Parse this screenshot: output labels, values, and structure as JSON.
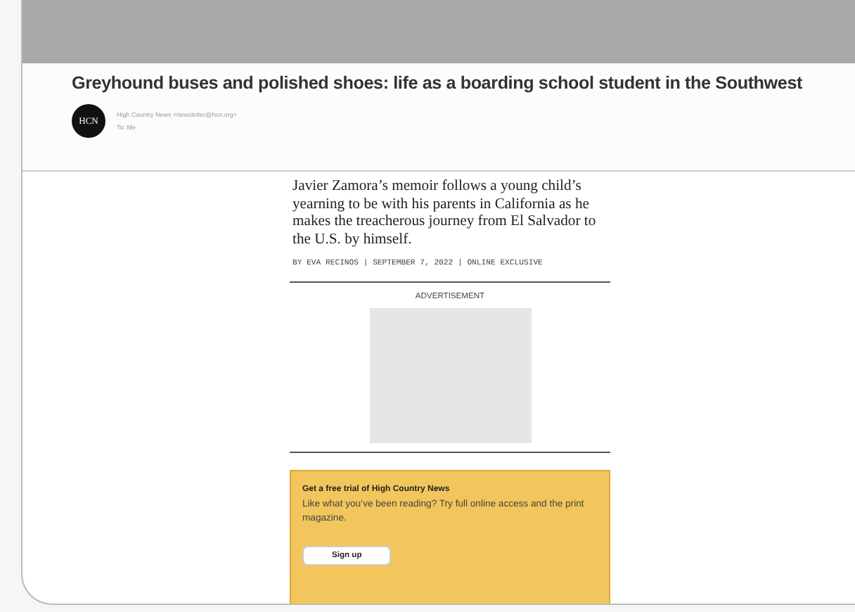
{
  "email": {
    "subject": "Greyhound buses and polished shoes: life as a boarding school student in the Southwest",
    "avatar": "HCN",
    "sender": "High Country News <newsletter@hcn.org>",
    "recipient": "To: Me"
  },
  "article": {
    "summary": "Javier Zamora’s memoir follows a young child’s yearning to be with his parents in California as he makes the treacherous journey from El Salvador to the U.S. by himself.",
    "byline": "BY EVA RECINOS | SEPTEMBER 7, 2022 | ONLINE EXCLUSIVE"
  },
  "ad": {
    "label": "ADVERTISEMENT"
  },
  "promo": {
    "title": "Get a free trial of High Country News",
    "text": "Like what you’ve been reading? Try full online access and the print magazine.",
    "button": "Sign up"
  }
}
